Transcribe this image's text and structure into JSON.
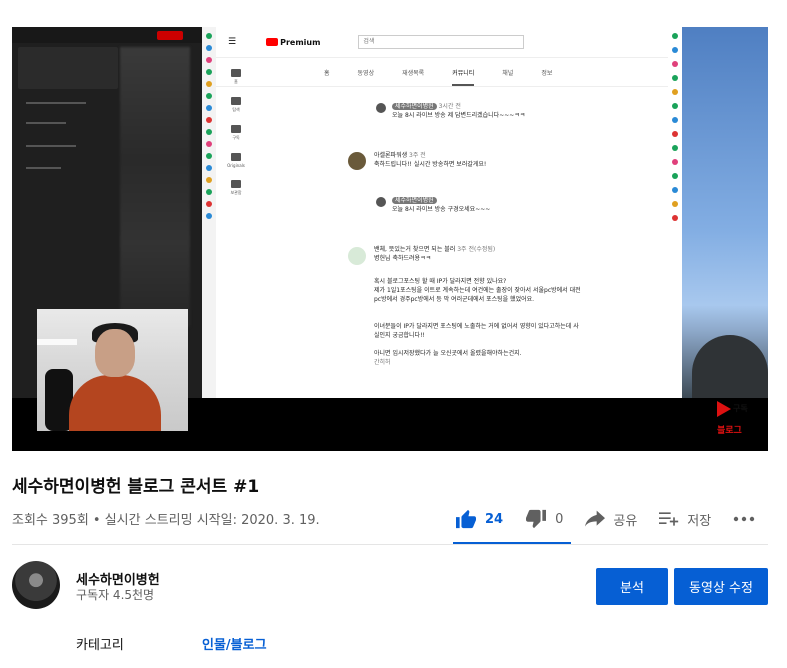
{
  "video": {
    "title": "세수하면이병헌 블로그 콘서트 #1",
    "meta": "조회수 395회 • 실시간 스트리밍 시작일: 2020. 3. 19."
  },
  "player": {
    "overlay_brand": "Premium",
    "overlay_search": "검색",
    "overlay_tabs": [
      "홈",
      "동영상",
      "재생목록",
      "커뮤니티",
      "채널",
      "정보"
    ],
    "overlay_left_nav": [
      "홈",
      "탐색",
      "구독",
      "Originals",
      "보관함"
    ],
    "comments": [
      {
        "author": "세수하면이병헌",
        "time": "3시간 전",
        "text": "오늘 8시 라이브 방송 제 답변드리겠습니다~~~ㅋㅋ"
      },
      {
        "author": "아셀론파워생",
        "time": "3주 전",
        "text": "축하드립니다!! 실시간 방송하면 보러갈게요!"
      },
      {
        "author": "세수하면이병헌",
        "time": "3시간 전",
        "text": "오늘 8시 라이브 방송 구경오세요~~~"
      },
      {
        "author": "밴체, 뜻있는거 찾으면 되는 블러",
        "time": "3주 전(수정됨)",
        "text": "병헌님 축하드려용ㅋㅋ"
      }
    ],
    "long_comment": [
      "혹시 블로그포스팅 할 때 IP가 달라지면 전향 있나요?",
      "제가 1일1포스팅을 이트로 계속하는데 여건에는 출장이 잦아서 서울pc방에서 대전",
      "pc방에서 경주pc방에서 등 막 여러군데에서 포스팅을 했었어요.",
      "이녀분들이 IP가 달라지면 포스팅에 노출하는 거에 없어서 영향이 있다고하는데  사",
      "실인지 궁금합니다!!",
      "아니면 임시저장했다가 늘 오신곳에서 올렸을해야하는건지.",
      "간히허"
    ],
    "subscribe_label": "구독",
    "subscribe_sub": "블로그"
  },
  "actions": {
    "like_count": "24",
    "dislike_count": "0",
    "share_label": "공유",
    "save_label": "저장"
  },
  "channel": {
    "name": "세수하면이병헌",
    "subscribers": "구독자 4.5천명"
  },
  "buttons": {
    "analytics": "분석",
    "edit_video": "동영상 수정"
  },
  "category": {
    "label": "카테고리",
    "value": "인물/블로그"
  },
  "colors": {
    "accent": "#065fd4",
    "muted_text": "#606060",
    "youtube_red": "#ff0000"
  }
}
